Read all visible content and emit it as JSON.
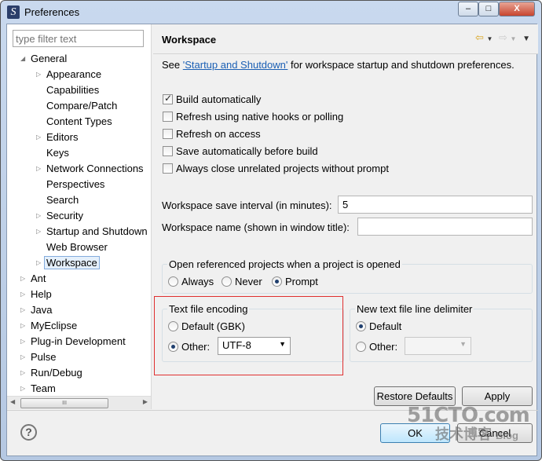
{
  "window": {
    "title": "Preferences",
    "minimize": "–",
    "maximize": "□",
    "close": "X"
  },
  "filter": {
    "placeholder": "type filter text"
  },
  "tree": [
    {
      "label": "General",
      "level": 0,
      "expanded": true
    },
    {
      "label": "Appearance",
      "level": 1,
      "expandable": true
    },
    {
      "label": "Capabilities",
      "level": 1
    },
    {
      "label": "Compare/Patch",
      "level": 1
    },
    {
      "label": "Content Types",
      "level": 1
    },
    {
      "label": "Editors",
      "level": 1,
      "expandable": true
    },
    {
      "label": "Keys",
      "level": 1
    },
    {
      "label": "Network Connections",
      "level": 1,
      "expandable": true
    },
    {
      "label": "Perspectives",
      "level": 1
    },
    {
      "label": "Search",
      "level": 1
    },
    {
      "label": "Security",
      "level": 1,
      "expandable": true
    },
    {
      "label": "Startup and Shutdown",
      "level": 1,
      "expandable": true
    },
    {
      "label": "Web Browser",
      "level": 1
    },
    {
      "label": "Workspace",
      "level": 1,
      "expandable": true,
      "selected": true
    },
    {
      "label": "Ant",
      "level": 0,
      "expandable": true
    },
    {
      "label": "Help",
      "level": 0,
      "expandable": true
    },
    {
      "label": "Java",
      "level": 0,
      "expandable": true
    },
    {
      "label": "MyEclipse",
      "level": 0,
      "expandable": true
    },
    {
      "label": "Plug-in Development",
      "level": 0,
      "expandable": true
    },
    {
      "label": "Pulse",
      "level": 0,
      "expandable": true
    },
    {
      "label": "Run/Debug",
      "level": 0,
      "expandable": true
    },
    {
      "label": "Team",
      "level": 0,
      "expandable": true
    }
  ],
  "scroll_thumb": "III",
  "page": {
    "title": "Workspace",
    "intro_prefix": "See ",
    "intro_link": "'Startup and Shutdown'",
    "intro_suffix": " for workspace startup and shutdown preferences.",
    "checkboxes": [
      {
        "label": "Build automatically",
        "checked": true
      },
      {
        "label": "Refresh using native hooks or polling",
        "checked": false
      },
      {
        "label": "Refresh on access",
        "checked": false
      },
      {
        "label": "Save automatically before build",
        "checked": false
      },
      {
        "label": "Always close unrelated projects without prompt",
        "checked": false
      }
    ],
    "save_interval_label": "Workspace save interval (in minutes):",
    "save_interval_value": "5",
    "ws_name_label": "Workspace name (shown in window title):",
    "ws_name_value": "",
    "open_ref": {
      "label": "Open referenced projects when a project is opened",
      "options": [
        "Always",
        "Never",
        "Prompt"
      ],
      "selected": "Prompt"
    },
    "encoding": {
      "label": "Text file encoding",
      "default_label": "Default (GBK)",
      "other_label": "Other:",
      "other_value": "UTF-8",
      "selected": "Other"
    },
    "delimiter": {
      "label": "New text file line delimiter",
      "default_label": "Default",
      "other_label": "Other:",
      "other_value": "",
      "selected": "Default"
    },
    "restore_defaults": "Restore Defaults",
    "apply": "Apply"
  },
  "footer": {
    "help": "?",
    "ok": "OK",
    "cancel": "Cancel"
  },
  "watermark": {
    "line1": "51CTO.com",
    "line2": "技术博客",
    "line3": "Blog"
  }
}
